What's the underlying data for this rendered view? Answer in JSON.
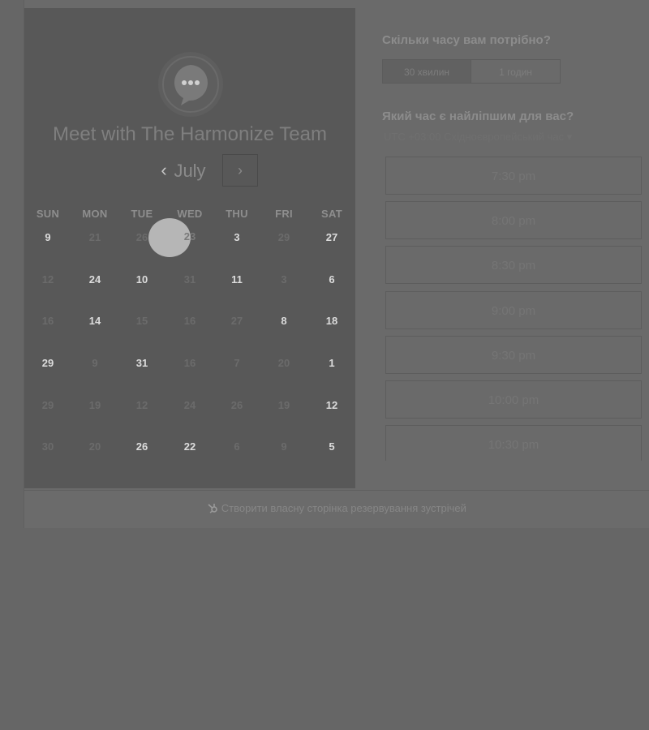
{
  "header": {
    "title": "Meet with The Harmonize Team",
    "month": "July",
    "prev_icon": "‹",
    "next_icon": "›"
  },
  "calendar": {
    "weekdays": [
      "SUN",
      "MON",
      "TUE",
      "WED",
      "THU",
      "FRI",
      "SAT"
    ],
    "rows": [
      [
        "9",
        "21",
        "26",
        "23",
        "3",
        "29",
        "27"
      ],
      [
        "12",
        "24",
        "10",
        "31",
        "11",
        "3",
        "6"
      ],
      [
        "16",
        "14",
        "15",
        "16",
        "27",
        "8",
        "18"
      ],
      [
        "29",
        "9",
        "31",
        "16",
        "7",
        "20",
        "1"
      ],
      [
        "29",
        "19",
        "12",
        "24",
        "26",
        "19",
        "12"
      ],
      [
        "30",
        "20",
        "26",
        "22",
        "6",
        "9",
        "5"
      ]
    ],
    "selected_day": "23"
  },
  "booking": {
    "duration_question": "Скільки часу вам потрібно?",
    "durations": [
      "30 хвилин",
      "1 годин"
    ],
    "time_question": "Який час є найліпшим для вас?",
    "timezone": "UTC +03:00 Східноєвропейський час",
    "slots": [
      "7:30 pm",
      "8:00 pm",
      "8:30 pm",
      "9:00 pm",
      "9:30 pm",
      "10:00 pm",
      "10:30 pm"
    ]
  },
  "footer": {
    "link": "Створити власну сторінка резервування зустрічей"
  }
}
